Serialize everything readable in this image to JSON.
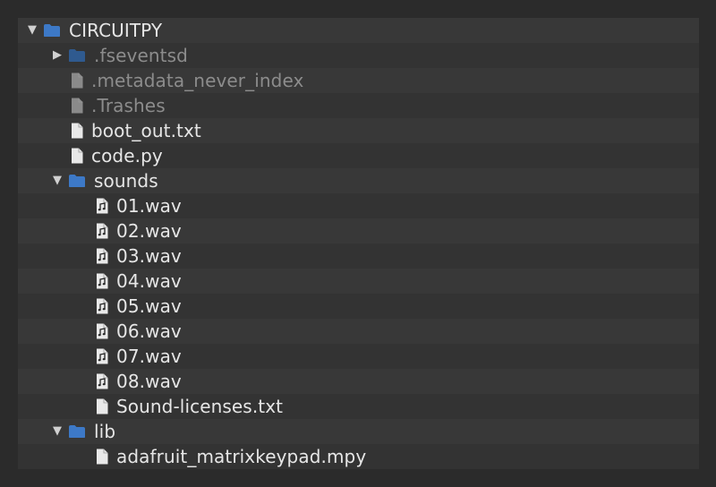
{
  "tree": [
    {
      "label": "CIRCUITPY",
      "level": 0,
      "type": "folder",
      "expander": "expanded",
      "dim": false
    },
    {
      "label": ".fseventsd",
      "level": 1,
      "type": "folder",
      "expander": "collapsed",
      "dim": true
    },
    {
      "label": ".metadata_never_index",
      "level": 1,
      "type": "file",
      "expander": "none",
      "dim": true
    },
    {
      "label": ".Trashes",
      "level": 1,
      "type": "file",
      "expander": "none",
      "dim": true
    },
    {
      "label": "boot_out.txt",
      "level": 1,
      "type": "file",
      "expander": "none",
      "dim": false
    },
    {
      "label": "code.py",
      "level": 1,
      "type": "file",
      "expander": "none",
      "dim": false
    },
    {
      "label": "sounds",
      "level": 1,
      "type": "folder",
      "expander": "expanded",
      "dim": false
    },
    {
      "label": "01.wav",
      "level": 2,
      "type": "audio",
      "expander": "none",
      "dim": false
    },
    {
      "label": "02.wav",
      "level": 2,
      "type": "audio",
      "expander": "none",
      "dim": false
    },
    {
      "label": "03.wav",
      "level": 2,
      "type": "audio",
      "expander": "none",
      "dim": false
    },
    {
      "label": "04.wav",
      "level": 2,
      "type": "audio",
      "expander": "none",
      "dim": false
    },
    {
      "label": "05.wav",
      "level": 2,
      "type": "audio",
      "expander": "none",
      "dim": false
    },
    {
      "label": "06.wav",
      "level": 2,
      "type": "audio",
      "expander": "none",
      "dim": false
    },
    {
      "label": "07.wav",
      "level": 2,
      "type": "audio",
      "expander": "none",
      "dim": false
    },
    {
      "label": "08.wav",
      "level": 2,
      "type": "audio",
      "expander": "none",
      "dim": false
    },
    {
      "label": "Sound-licenses.txt",
      "level": 2,
      "type": "file",
      "expander": "none",
      "dim": false
    },
    {
      "label": "lib",
      "level": 1,
      "type": "folder",
      "expander": "expanded",
      "dim": false
    },
    {
      "label": "adafruit_matrixkeypad.mpy",
      "level": 2,
      "type": "file",
      "expander": "none",
      "dim": false
    }
  ],
  "colors": {
    "folder": "#3d79c7",
    "folder_dim": "#2f5a8f",
    "file": "#e9e9e9",
    "file_dim": "#8a8a8a"
  }
}
